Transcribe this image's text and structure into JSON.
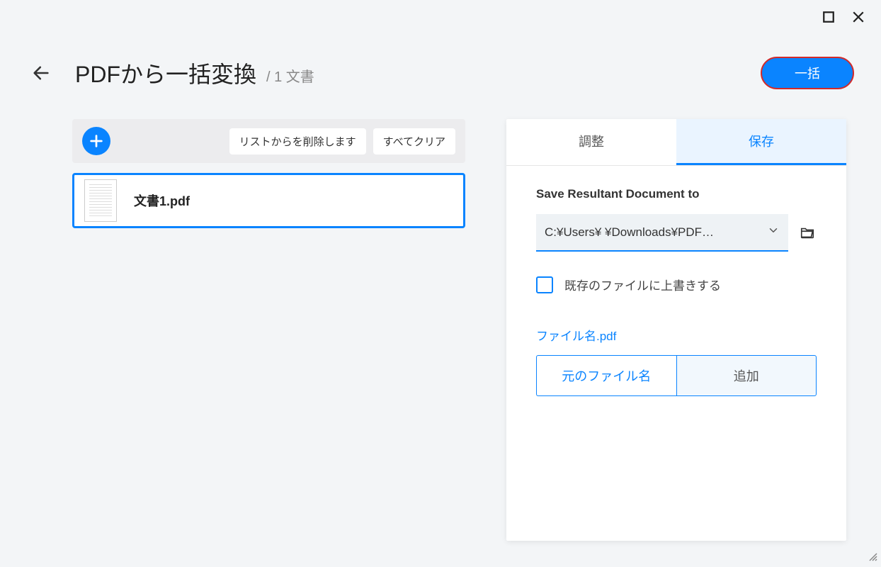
{
  "window": {
    "maximize_icon": "maximize",
    "close_icon": "close"
  },
  "header": {
    "back_icon": "arrow-left",
    "title": "PDFから一括変換",
    "subtitle": "/ 1 文書",
    "batch_label": "一括"
  },
  "toolbar": {
    "add_icon": "plus",
    "remove_label": "リストからを削除します",
    "clear_label": "すべてクリア"
  },
  "files": [
    {
      "name": "文書1.pdf"
    }
  ],
  "tabs": {
    "adjust": "調整",
    "save": "保存"
  },
  "save_panel": {
    "section_label": "Save Resultant Document to",
    "path": "C:¥Users¥        ¥Downloads¥PDF…",
    "overwrite_label": "既存のファイルに上書きする",
    "filename_heading": "ファイル名.pdf",
    "original_name_label": "元のファイル名",
    "add_label": "追加"
  }
}
